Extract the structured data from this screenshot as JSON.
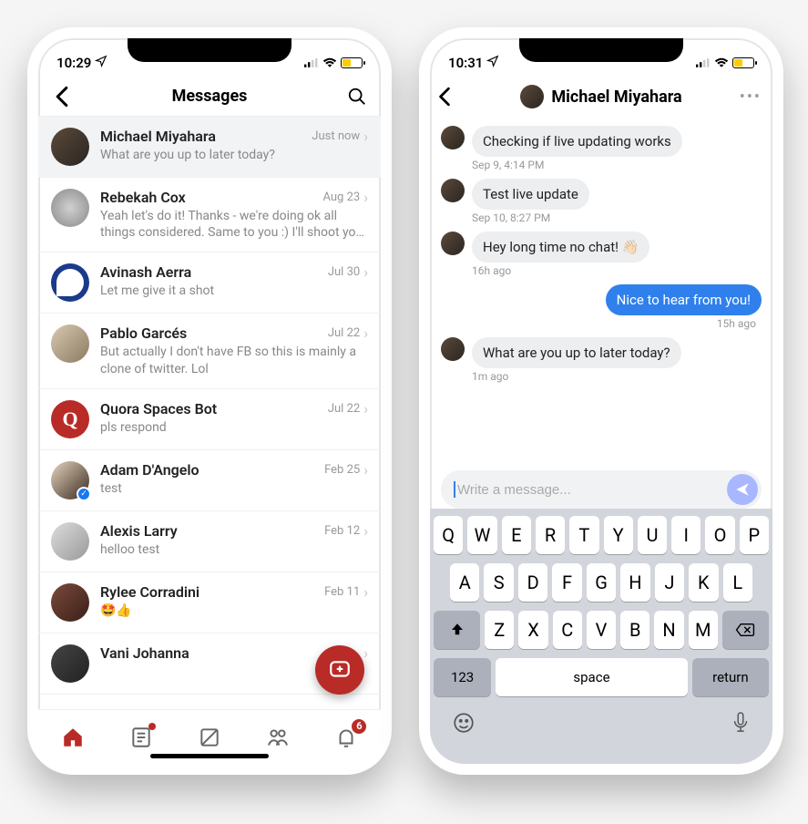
{
  "left": {
    "status": {
      "time": "10:29"
    },
    "header": {
      "title": "Messages"
    },
    "conversations": [
      {
        "name": "Michael Miyahara",
        "preview": "What are you up to later today?",
        "time": "Just now",
        "selected": true,
        "avatarClass": "av-a"
      },
      {
        "name": "Rebekah Cox",
        "preview": "Yeah let's do it! Thanks - we're doing ok all things considered. Same to you :) I'll shoot yo…",
        "time": "Aug 23",
        "avatarClass": "av-b"
      },
      {
        "name": "Avinash Aerra",
        "preview": "Let me give it a shot",
        "time": "Jul 30",
        "avatarClass": "av-c"
      },
      {
        "name": "Pablo Garcés",
        "preview": "But actually I don't have FB so this is mainly a clone of twitter. Lol",
        "time": "Jul 22",
        "avatarClass": "av-d"
      },
      {
        "name": "Quora Spaces Bot",
        "preview": "pls respond",
        "time": "Jul 22",
        "avatarClass": "av-e",
        "avatarLetter": "Q"
      },
      {
        "name": "Adam D'Angelo",
        "preview": "test",
        "time": "Feb 25",
        "avatarClass": "av-f",
        "verified": true
      },
      {
        "name": "Alexis Larry",
        "preview": "helloo test",
        "time": "Feb 12",
        "avatarClass": "av-g"
      },
      {
        "name": "Rylee Corradini",
        "preview": "🤩👍",
        "time": "Feb 11",
        "avatarClass": "av-h"
      },
      {
        "name": "Vani Johanna",
        "preview": "",
        "time": "",
        "avatarClass": "av-i"
      }
    ],
    "tabs": {
      "notifications_badge": "6"
    }
  },
  "right": {
    "status": {
      "time": "10:31"
    },
    "header": {
      "title": "Michael Miyahara"
    },
    "messages": [
      {
        "dir": "in",
        "text": "Checking if live updating works",
        "ts": "Sep 9, 4:14 PM",
        "showAvatar": true
      },
      {
        "dir": "in",
        "text": "Test live update",
        "ts": "Sep 10, 8:27 PM",
        "showAvatar": true
      },
      {
        "dir": "in",
        "text": "Hey long time no chat! 👋🏻",
        "ts": "16h ago",
        "showAvatar": true
      },
      {
        "dir": "out",
        "text": "Nice to hear from you!",
        "ts": "15h ago"
      },
      {
        "dir": "in",
        "text": "What are you up to later today?",
        "ts": "1m ago",
        "showAvatar": true
      }
    ],
    "composer": {
      "placeholder": "Write a message..."
    },
    "keyboard": {
      "row1": [
        "Q",
        "W",
        "E",
        "R",
        "T",
        "Y",
        "U",
        "I",
        "O",
        "P"
      ],
      "row2": [
        "A",
        "S",
        "D",
        "F",
        "G",
        "H",
        "J",
        "K",
        "L"
      ],
      "row3": [
        "Z",
        "X",
        "C",
        "V",
        "B",
        "N",
        "M"
      ],
      "numKey": "123",
      "spaceKey": "space",
      "returnKey": "return"
    }
  }
}
